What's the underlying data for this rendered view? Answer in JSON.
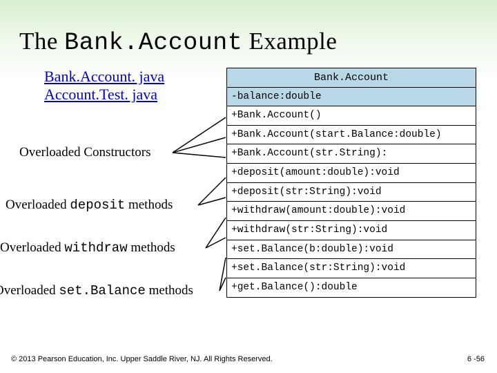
{
  "title": {
    "pre": "The ",
    "code": "Bank.Account",
    "post": " Example"
  },
  "links": {
    "l1": "Bank.Account. java",
    "l2": "Account.Test. java"
  },
  "labels": {
    "constructors": "Overloaded Constructors",
    "deposit_pre": "Overloaded ",
    "deposit_code": "deposit",
    "deposit_post": " methods",
    "withdraw_pre": "Overloaded ",
    "withdraw_code": "withdraw",
    "withdraw_post": " methods",
    "setbalance_pre": "Overloaded ",
    "setbalance_code": "set.Balance",
    "setbalance_post": " methods"
  },
  "uml": {
    "name": "Bank.Account",
    "attr": "-balance:double",
    "ops": [
      "+Bank.Account()",
      "+Bank.Account(start.Balance:double)",
      "+Bank.Account(str.String):",
      "+deposit(amount:double):void",
      "+deposit(str:String):void",
      "+withdraw(amount:double):void",
      "+withdraw(str:String):void",
      "+set.Balance(b:double):void",
      "+set.Balance(str:String):void",
      "+get.Balance():double"
    ]
  },
  "footer": "© 2013 Pearson Education, Inc. Upper Saddle River, NJ. All Rights Reserved.",
  "pagenum": "6 -56"
}
